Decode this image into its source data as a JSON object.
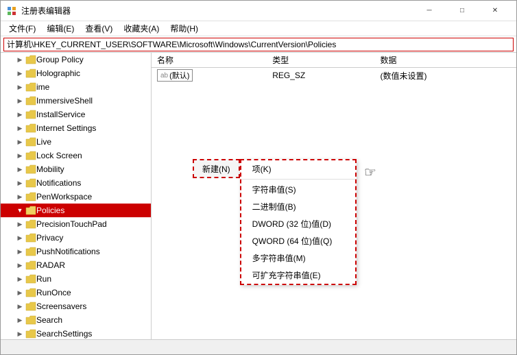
{
  "window": {
    "title": "注册表编辑器",
    "controls": {
      "minimize": "─",
      "maximize": "□",
      "close": "✕"
    }
  },
  "menu": {
    "items": [
      "文件(F)",
      "编辑(E)",
      "查看(V)",
      "收藏夹(A)",
      "帮助(H)"
    ]
  },
  "address": {
    "path": "计算机\\HKEY_CURRENT_USER\\SOFTWARE\\Microsoft\\Windows\\CurrentVersion\\Policies"
  },
  "table": {
    "headers": [
      "名称",
      "类型",
      "数据"
    ],
    "rows": [
      {
        "name": "(默认)",
        "type": "REG_SZ",
        "data": "(数值未设置)"
      }
    ]
  },
  "tree": {
    "items": [
      {
        "label": "Group Policy",
        "indent": 2,
        "selected": false
      },
      {
        "label": "Holographic",
        "indent": 2,
        "selected": false
      },
      {
        "label": "ime",
        "indent": 2,
        "selected": false
      },
      {
        "label": "ImmersiveShell",
        "indent": 2,
        "selected": false
      },
      {
        "label": "InstallService",
        "indent": 2,
        "selected": false
      },
      {
        "label": "Internet Settings",
        "indent": 2,
        "selected": false
      },
      {
        "label": "Live",
        "indent": 2,
        "selected": false
      },
      {
        "label": "Lock Screen",
        "indent": 2,
        "selected": false
      },
      {
        "label": "Mobility",
        "indent": 2,
        "selected": false
      },
      {
        "label": "Notifications",
        "indent": 2,
        "selected": false
      },
      {
        "label": "PenWorkspace",
        "indent": 2,
        "selected": false
      },
      {
        "label": "Policies",
        "indent": 2,
        "selected": true
      },
      {
        "label": "PrecisionTouchPad",
        "indent": 2,
        "selected": false
      },
      {
        "label": "Privacy",
        "indent": 2,
        "selected": false
      },
      {
        "label": "PushNotifications",
        "indent": 2,
        "selected": false
      },
      {
        "label": "RADAR",
        "indent": 2,
        "selected": false
      },
      {
        "label": "Run",
        "indent": 2,
        "selected": false
      },
      {
        "label": "RunOnce",
        "indent": 2,
        "selected": false
      },
      {
        "label": "Screensavers",
        "indent": 2,
        "selected": false
      },
      {
        "label": "Search",
        "indent": 2,
        "selected": false
      },
      {
        "label": "SearchSettings",
        "indent": 2,
        "selected": false
      }
    ]
  },
  "context": {
    "new_button_label": "新建(N)",
    "menu_items": [
      {
        "label": "项(K)",
        "hovered": false
      },
      {
        "label": "字符串值(S)",
        "hovered": false
      },
      {
        "label": "二进制值(B)",
        "hovered": false
      },
      {
        "label": "DWORD (32 位)值(D)",
        "hovered": false
      },
      {
        "label": "QWORD (64 位)值(Q)",
        "hovered": false
      },
      {
        "label": "多字符串值(M)",
        "hovered": false
      },
      {
        "label": "可扩充字符串值(E)",
        "hovered": false
      }
    ]
  }
}
